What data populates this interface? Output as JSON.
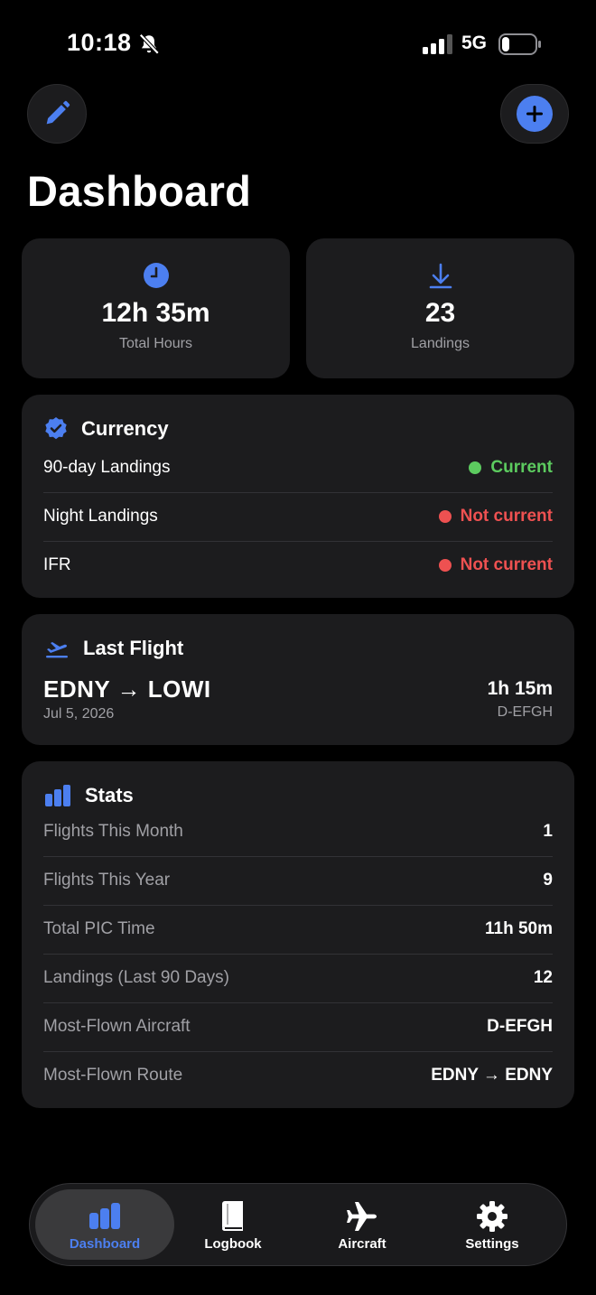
{
  "status": {
    "time": "10:18",
    "network": "5G"
  },
  "page": {
    "title": "Dashboard"
  },
  "tiles": {
    "hours": {
      "value": "12h 35m",
      "label": "Total Hours",
      "icon": "clock-icon"
    },
    "landings": {
      "value": "23",
      "label": "Landings",
      "icon": "arrow-down-icon"
    }
  },
  "currency": {
    "title": "Currency",
    "rows": [
      {
        "label": "90-day Landings",
        "status": "Current"
      },
      {
        "label": "Night Landings",
        "status": "Not current"
      },
      {
        "label": "IFR",
        "status": "Not current"
      }
    ]
  },
  "last_flight": {
    "title": "Last Flight",
    "route": "EDNY → LOWI",
    "date": "Jul 5, 2026",
    "duration": "1h 15m",
    "aircraft": "D-EFGH"
  },
  "stats": {
    "title": "Stats",
    "rows": [
      {
        "label": "Flights This Month",
        "value": "1"
      },
      {
        "label": "Flights This Year",
        "value": "9"
      },
      {
        "label": "Total PIC Time",
        "value": "11h 50m"
      },
      {
        "label": "Landings (Last 90 Days)",
        "value": "12"
      },
      {
        "label": "Most-Flown Aircraft",
        "value": "D-EFGH"
      },
      {
        "label": "Most-Flown Route",
        "value": "EDNY → EDNY"
      }
    ]
  },
  "tabs": [
    {
      "label": "Dashboard",
      "icon": "bar-chart-icon",
      "active": true
    },
    {
      "label": "Logbook",
      "icon": "book-icon",
      "active": false
    },
    {
      "label": "Aircraft",
      "icon": "airplane-icon",
      "active": false
    },
    {
      "label": "Settings",
      "icon": "gear-icon",
      "active": false
    }
  ],
  "colors": {
    "accent": "#4c7ff0",
    "ok": "#5ccb5f",
    "bad": "#ee5151",
    "card": "#1c1c1e"
  }
}
